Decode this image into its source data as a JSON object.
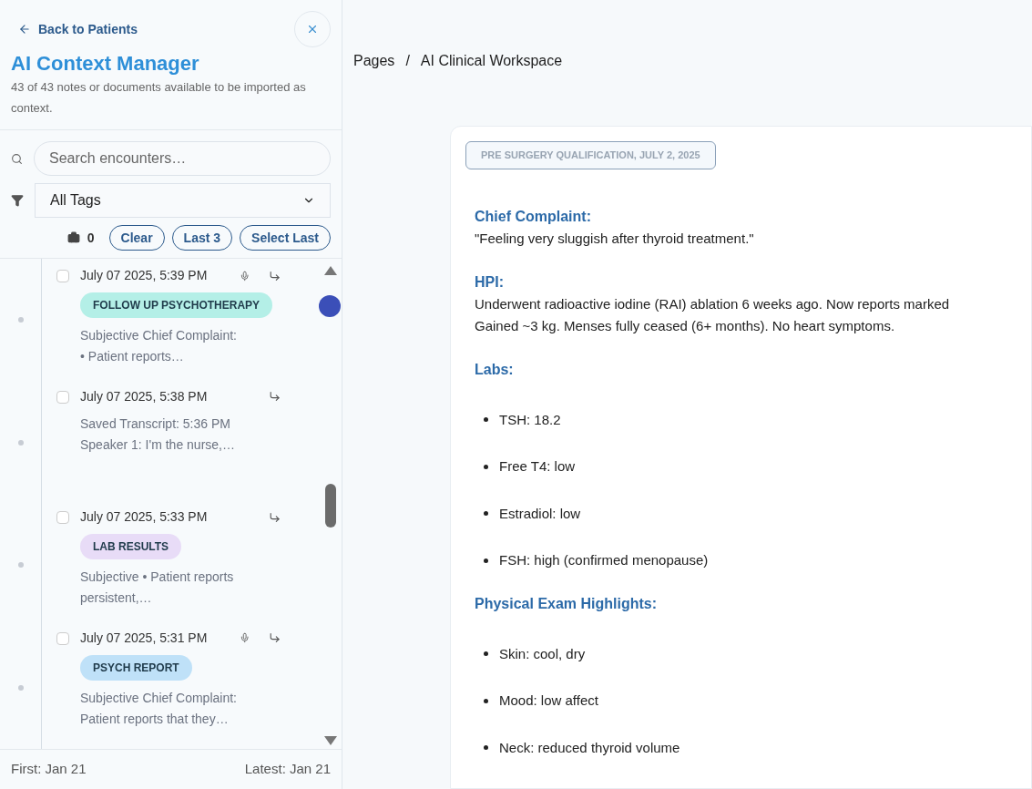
{
  "sidebar": {
    "back_link": "Back to Patients",
    "title": "AI Context Manager",
    "subtitle": "43 of 43 notes or documents available to be imported as context.",
    "search": {
      "placeholder": "Search encounters…"
    },
    "tag_filter": {
      "value": "All Tags"
    },
    "selection_count": "0",
    "buttons": [
      "Clear",
      "Last 3",
      "Select Last"
    ],
    "entries": [
      {
        "timestamp": "July 07 2025, 5:39 PM",
        "checked": false,
        "audio": true,
        "tag": {
          "label": "FOLLOW UP PSYCHOTHERAPY",
          "color": "#b4efe7"
        },
        "preview": [
          "Subjective Chief Complaint:",
          "• Patient reports…"
        ]
      },
      {
        "timestamp": "July 07 2025, 5:38 PM",
        "checked": false,
        "audio": false,
        "preview": [
          "Saved Transcript: 5:36 PM",
          "Speaker 1: I'm the nurse,…"
        ]
      },
      {
        "timestamp": "July 07 2025, 5:33 PM",
        "checked": false,
        "audio": false,
        "tag": {
          "label": "LAB RESULTS",
          "color": "#e8dcf7"
        },
        "preview": [
          "Subjective • Patient reports",
          "persistent,…"
        ]
      },
      {
        "timestamp": "July 07 2025, 5:31 PM",
        "checked": false,
        "audio": true,
        "tag": {
          "label": "PSYCH REPORT",
          "color": "#bfe1f8"
        },
        "preview": [
          "Subjective Chief Complaint:",
          "Patient reports that they…"
        ]
      }
    ],
    "footer": {
      "first": "First: Jan 21",
      "latest": "Latest: Jan 21"
    }
  },
  "breadcrumb": {
    "items": [
      "Pages",
      "AI Clinical Workspace"
    ],
    "separator": "/"
  },
  "note": {
    "badge": "PRE SURGERY QUALIFICATION, JULY 2, 2025",
    "sections": [
      {
        "heading": "Chief Complaint:",
        "kind": "text",
        "lines": [
          "\"Feeling very sluggish after thyroid treatment.\""
        ]
      },
      {
        "heading": "HPI:",
        "kind": "text",
        "lines": [
          "Underwent radioactive iodine (RAI) ablation 6 weeks ago. Now reports marked",
          "Gained ~3 kg. Menses fully ceased (6+ months). No heart symptoms."
        ]
      },
      {
        "heading": "Labs:",
        "kind": "list",
        "lines": [
          "TSH: 18.2",
          "Free T4: low",
          "Estradiol: low",
          "FSH: high (confirmed menopause)"
        ]
      },
      {
        "heading": "Physical Exam Highlights:",
        "kind": "list",
        "lines": [
          "Skin: cool, dry",
          "Mood: low affect",
          "Neck: reduced thyroid volume"
        ]
      }
    ]
  }
}
